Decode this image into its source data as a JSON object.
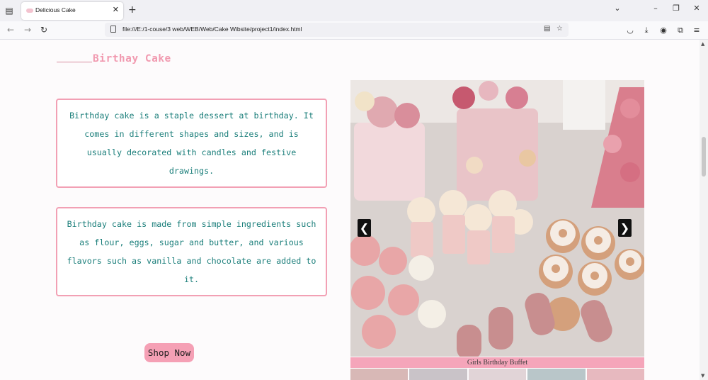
{
  "browser": {
    "tab_title": "Delicious Cake",
    "tab_close": "✕",
    "new_tab": "+",
    "url": "file:///E:/1-couse/3 web/WEB/Web/Cake Wibsite/project1/index.html",
    "window_controls": {
      "minimize": "–",
      "restore": "❐",
      "close": "✕"
    },
    "icons": [
      "tab-list-icon",
      "back-icon",
      "forward-icon",
      "reload-icon",
      "reader-view-icon",
      "bookmark-star-icon",
      "pocket-icon",
      "downloads-icon",
      "account-icon",
      "extensions-icon",
      "menu-icon"
    ]
  },
  "page": {
    "heading": "Birthay Cake",
    "card1_text": "Birthday cake is a staple dessert at birthday. It comes in different shapes and sizes, and is usually decorated with candles and festive drawings.",
    "card2_text": "Birthday cake is made from simple ingredients such as flour, eggs, sugar and butter, and various flavors such as vanilla and chocolate are added to it.",
    "shop_button": "Shop Now"
  },
  "slideshow": {
    "caption": "Girls Birthday Buffet",
    "prev_arrow": "❮",
    "next_arrow": "❯"
  },
  "colors": {
    "accent_pink": "#f19ab0",
    "text_teal": "#1a7e7a",
    "border_pink": "#f2a0b4",
    "button_pink": "#f5a0b5"
  }
}
